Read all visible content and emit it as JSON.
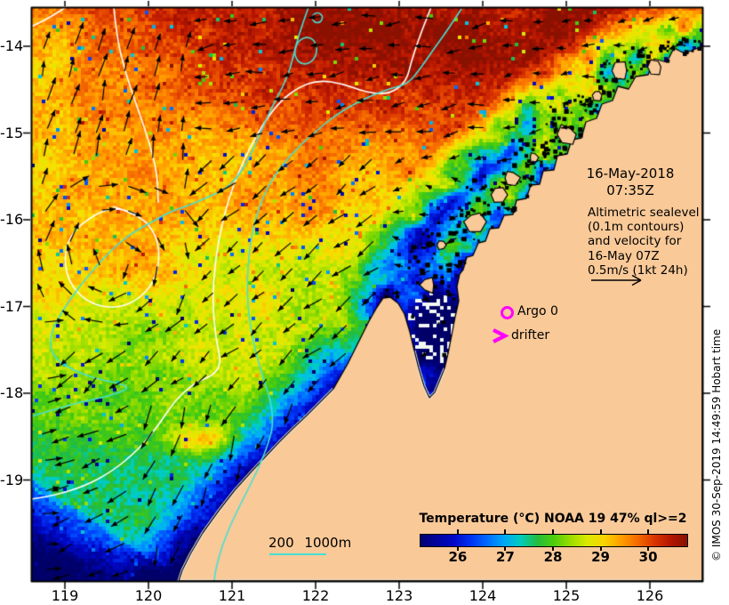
{
  "map": {
    "date_label": {
      "line1": "16-May-2018",
      "line2": "07:35Z"
    },
    "annotation": {
      "lines": [
        "Altimetric sealevel",
        "(0.1m contours)",
        "and velocity for",
        "16-May 07Z",
        "0.5m/s (1kt 24h)"
      ]
    },
    "markers": {
      "argo_label": "Argo 0",
      "drifter_label": "drifter"
    },
    "bathy_legend_label": "200 1000m",
    "copyright": "© IMOS 30-Sep-2019 14:49:59 Hobart time"
  },
  "axes": {
    "x_tick_labels": [
      "119",
      "120",
      "121",
      "122",
      "123",
      "124",
      "125",
      "126"
    ],
    "y_tick_labels": [
      "-14",
      "-15",
      "-16",
      "-17",
      "-18",
      "-19"
    ],
    "lon_range_est": [
      118.6,
      126.63
    ],
    "lat_range_est": [
      -20.16,
      -13.55
    ]
  },
  "colorbar": {
    "title": "Temperature (°C) NOAA 19 47% ql>=2",
    "tick_labels": [
      "26",
      "27",
      "28",
      "29",
      "30"
    ],
    "range_est": [
      25.2,
      30.8
    ]
  },
  "colors": {
    "land": "#f9c998",
    "marker_magenta": "#ff00ff",
    "sealevel_contour": "#ffffff",
    "bathymetry_contour": "#45e0d5"
  }
}
